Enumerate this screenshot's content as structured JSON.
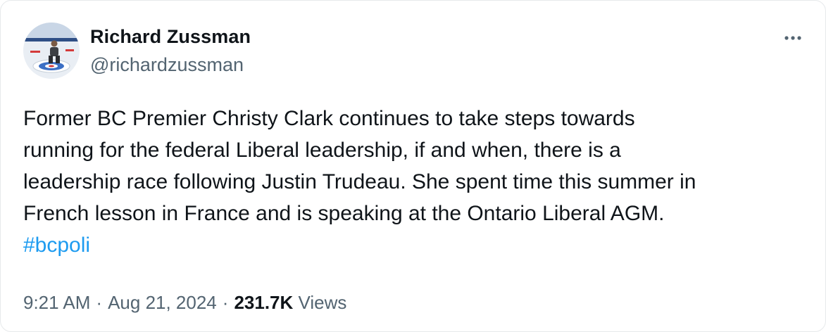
{
  "author": {
    "name": "Richard Zussman",
    "handle": "@richardzussman"
  },
  "tweet": {
    "text": "Former BC Premier Christy Clark continues to take steps towards\nrunning for the federal Liberal leadership, if and when, there is a\nleadership race following Justin Trudeau. She spent time this summer in\nFrench lesson in France and is speaking at the Ontario Liberal AGM.",
    "hashtag": "#bcpoli"
  },
  "meta": {
    "time": "9:21 AM",
    "separator": "·",
    "date": "Aug 21, 2024",
    "views_count": "231.7K",
    "views_label": "Views"
  },
  "icons": {
    "more": "more-icon",
    "avatar": "avatar-photo"
  },
  "colors": {
    "text": "#0f1419",
    "secondary": "#536471",
    "link": "#1d9bf0"
  }
}
